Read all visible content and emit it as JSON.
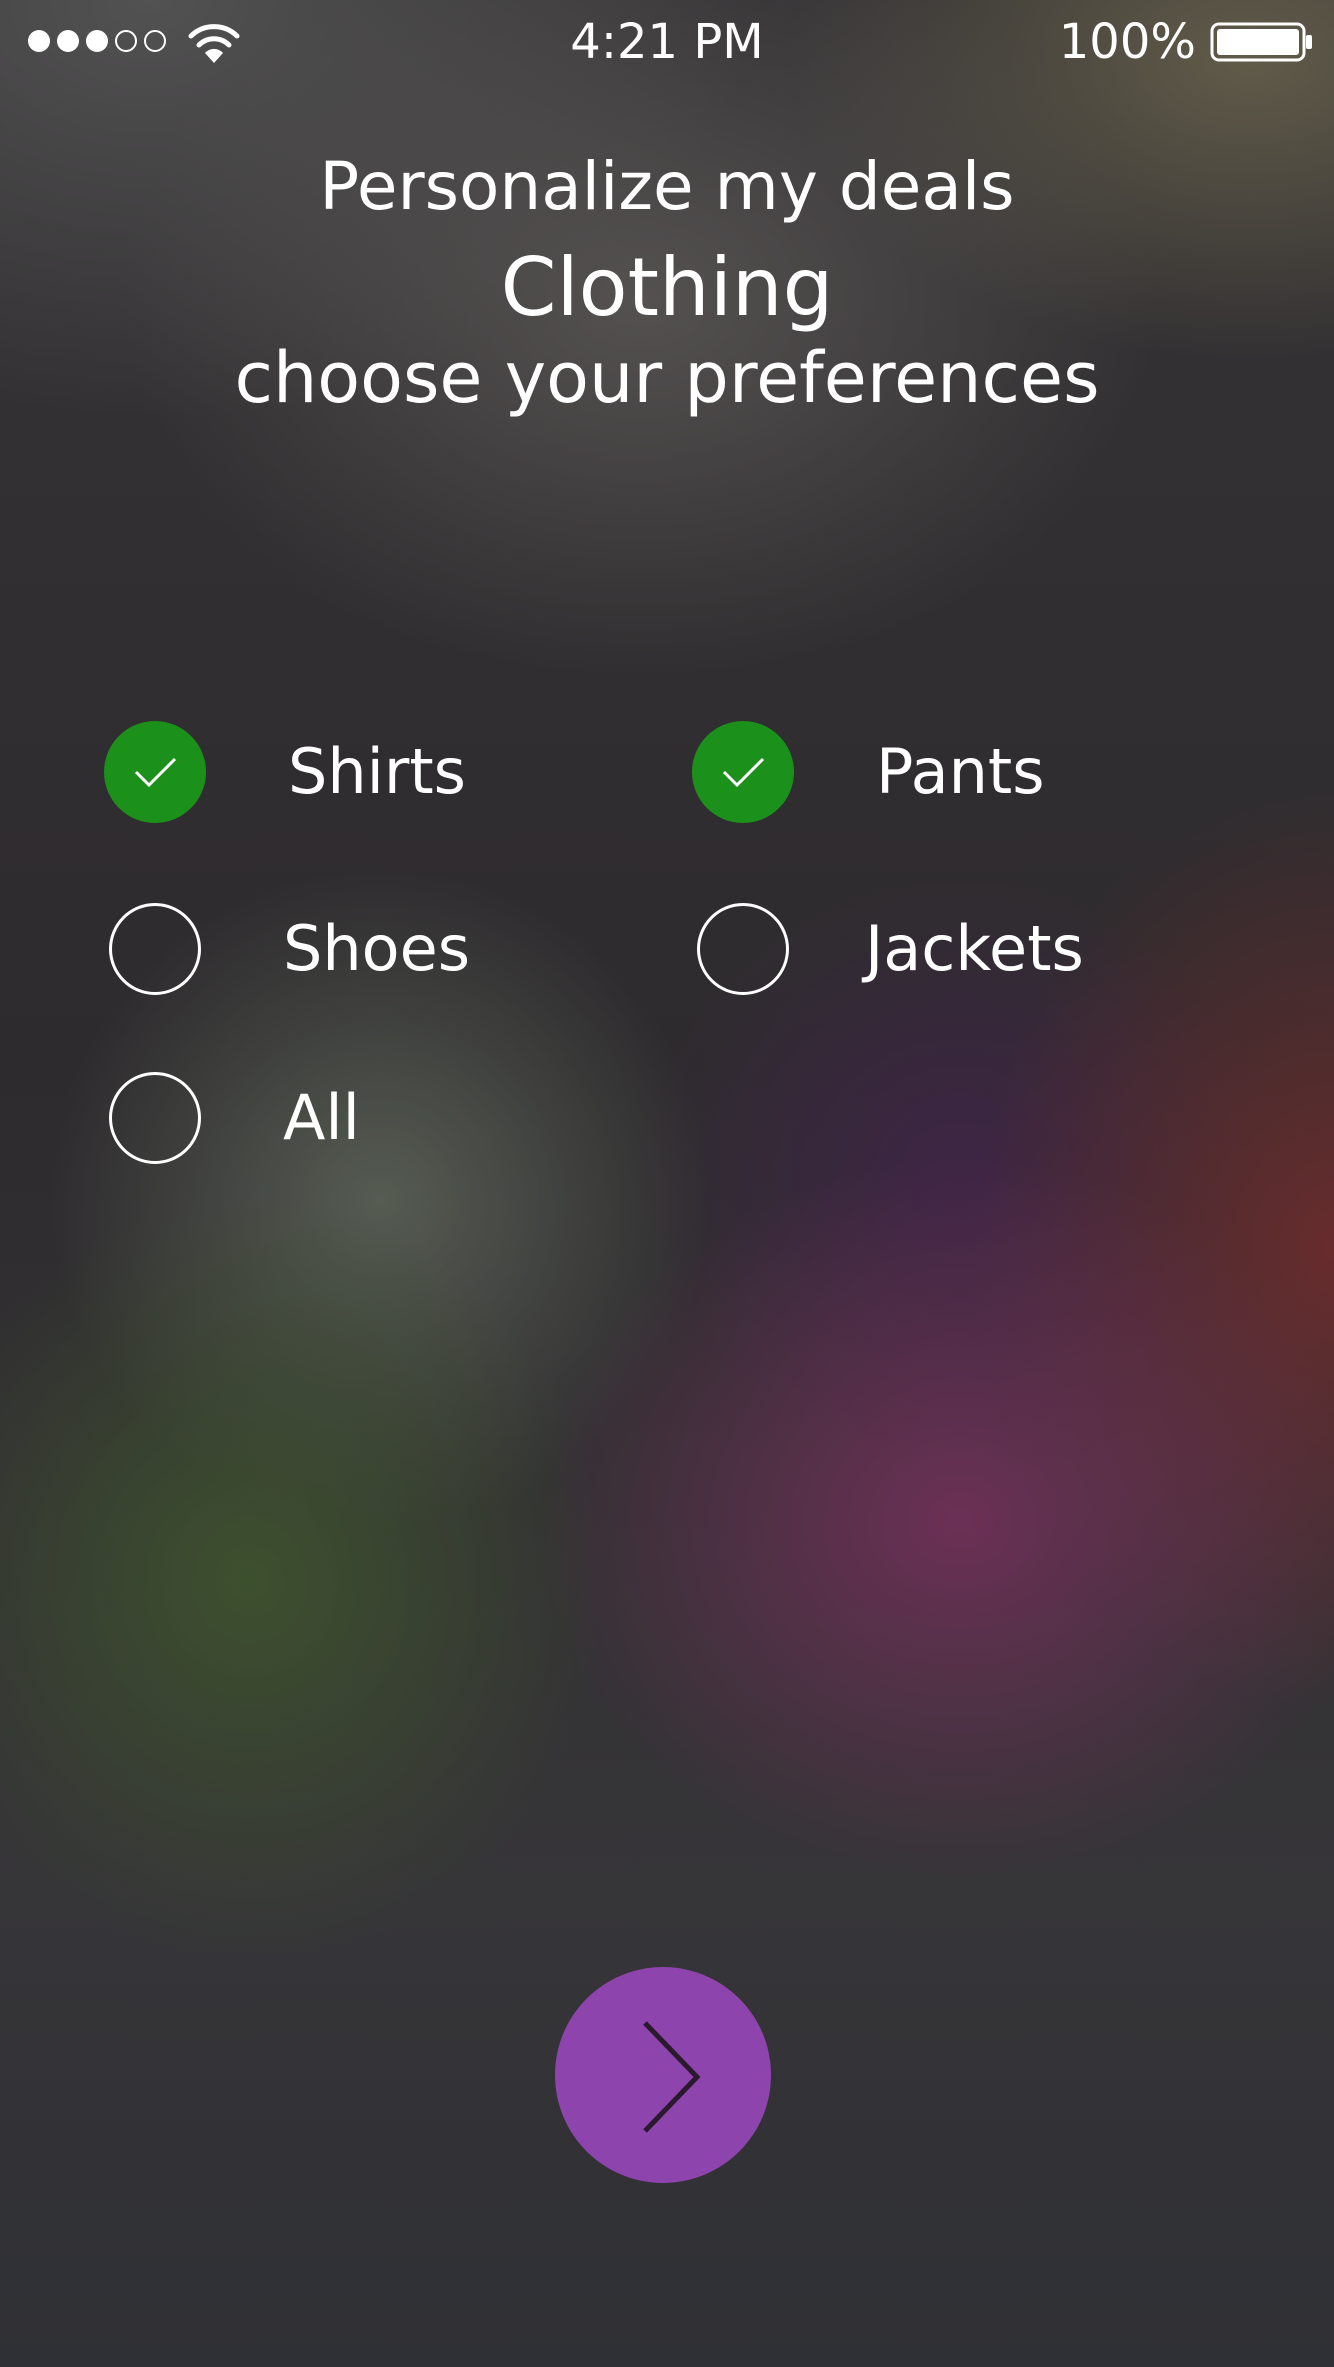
{
  "status_bar": {
    "time": "4:21 PM",
    "battery_percent": "100%",
    "signal_strength": 3,
    "signal_max": 5
  },
  "header": {
    "title": "Personalize my deals",
    "category": "Clothing",
    "subtitle": "choose your preferences"
  },
  "options": [
    {
      "label": "Shirts",
      "checked": true
    },
    {
      "label": "Pants",
      "checked": true
    },
    {
      "label": "Shoes",
      "checked": false
    },
    {
      "label": "Jackets",
      "checked": false
    },
    {
      "label": "All",
      "checked": false
    }
  ],
  "next_button": {
    "icon": "chevron-right-icon"
  },
  "colors": {
    "checked": "#1b911b",
    "accent": "#8e44ad"
  }
}
